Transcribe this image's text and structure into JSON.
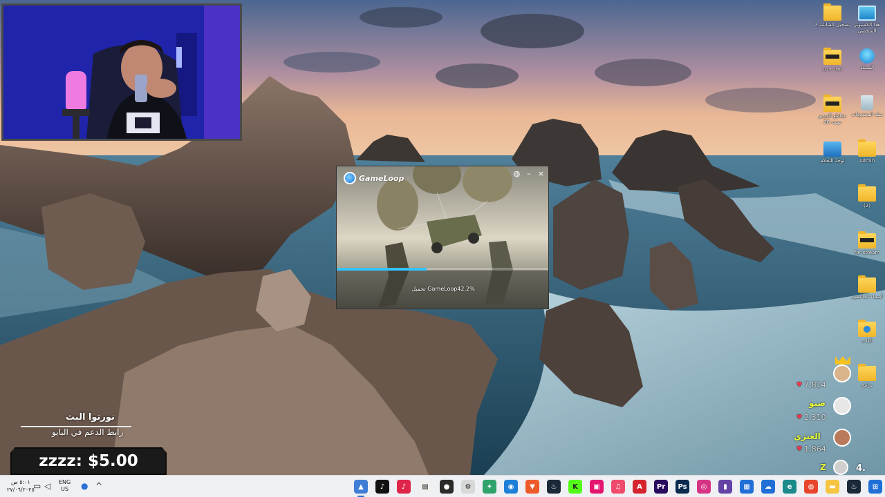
{
  "gameloop": {
    "logo_text": "GameLoop",
    "status_text": "تحميل GameLoop42.2%",
    "progress_fraction": 0.422
  },
  "desktop_icons": [
    {
      "label": "هذا الكمبيوتر الشخصي",
      "icon": "monitor-icon"
    },
    {
      "label": "تسجيل الشاشة ٤",
      "icon": "folder-icon"
    },
    {
      "label": "الشبكة",
      "icon": "network-icon"
    },
    {
      "label": "مجلد جديد",
      "icon": "folder-icon"
    },
    {
      "label": "سلة المحذوفات",
      "icon": "recycle-bin-icon"
    },
    {
      "label": "مقاطع الفيديو مهمه 26",
      "icon": "folder-icon"
    },
    {
      "label": "Admin",
      "icon": "folder-icon"
    },
    {
      "label": "لوحة التحكم",
      "icon": "control-panel-icon"
    },
    {
      "label": "(2)",
      "icon": "folder-icon"
    },
    {
      "label": "for stream",
      "icon": "folder-icon"
    },
    {
      "label": "أسماء الداعمين",
      "icon": "folder-icon"
    },
    {
      "label": "العاب",
      "icon": "folder-icon"
    },
    {
      "label": "برامج",
      "icon": "folder-icon"
    }
  ],
  "chat": [
    {
      "name": "",
      "likes": "7,814"
    },
    {
      "name": "صيو",
      "likes": "2,310"
    },
    {
      "name": "العنزي",
      "likes": "1,864"
    },
    {
      "name": "Z",
      "likes": "4."
    }
  ],
  "overlay": {
    "greeting": "نورتوا البث",
    "support_text": "رابط الدعم في البايو",
    "donation": "zzzz: $5.00"
  },
  "taskbar": {
    "time": "٥:٠١ ص",
    "date": "٢٧/٠٦/٢٠٢٥",
    "lang_top": "ENG",
    "lang_bottom": "US",
    "tray_icons": [
      "wifi-icon",
      "volume-icon",
      "battery-icon",
      "mic-icon",
      "chevron-up-icon"
    ],
    "apps": [
      {
        "name": "gameloop-app",
        "color": "#3f7dd6",
        "glyph": "▲"
      },
      {
        "name": "tiktok-app",
        "color": "#111111",
        "glyph": "♪"
      },
      {
        "name": "tiktok-live-app",
        "color": "#e0244a",
        "glyph": "♪"
      },
      {
        "name": "notepad-app",
        "color": "#f0f0f0",
        "glyph": "▤"
      },
      {
        "name": "obs-app",
        "color": "#2a2a2a",
        "glyph": "●"
      },
      {
        "name": "settings-app",
        "color": "#d8d8d8",
        "glyph": "⚙"
      },
      {
        "name": "widgets-app",
        "color": "#2fa36b",
        "glyph": "✦"
      },
      {
        "name": "chat-app",
        "color": "#1e7fd8",
        "glyph": "◉"
      },
      {
        "name": "brave-app",
        "color": "#ef5a29",
        "glyph": "▼"
      },
      {
        "name": "steam-app",
        "color": "#1b2838",
        "glyph": "♨"
      },
      {
        "name": "kick-app",
        "color": "#53fc18",
        "glyph": "K"
      },
      {
        "name": "streamlabs-app",
        "color": "#e4156e",
        "glyph": "▣"
      },
      {
        "name": "itunes-app",
        "color": "#f04a6c",
        "glyph": "♫"
      },
      {
        "name": "acrobat-app",
        "color": "#d6242f",
        "glyph": "A"
      },
      {
        "name": "premiere-app",
        "color": "#2a0a5e",
        "glyph": "Pr"
      },
      {
        "name": "photoshop-app",
        "color": "#0a2a4e",
        "glyph": "Ps"
      },
      {
        "name": "instagram-app",
        "color": "#d63384",
        "glyph": "◎"
      },
      {
        "name": "twitch-app",
        "color": "#6441a5",
        "glyph": "▮"
      },
      {
        "name": "store-app",
        "color": "#1f6fd6",
        "glyph": "▦"
      },
      {
        "name": "onedrive-app",
        "color": "#1f6fd6",
        "glyph": "☁"
      },
      {
        "name": "edge-app",
        "color": "#1a8a8a",
        "glyph": "e"
      },
      {
        "name": "chrome-app",
        "color": "#e8452c",
        "glyph": "◍"
      },
      {
        "name": "explorer-app",
        "color": "#f5c542",
        "glyph": "▬"
      },
      {
        "name": "steam-tray-app",
        "color": "#1b2838",
        "glyph": "♨"
      },
      {
        "name": "start-app",
        "color": "#1f6fd6",
        "glyph": "⊞"
      }
    ]
  }
}
